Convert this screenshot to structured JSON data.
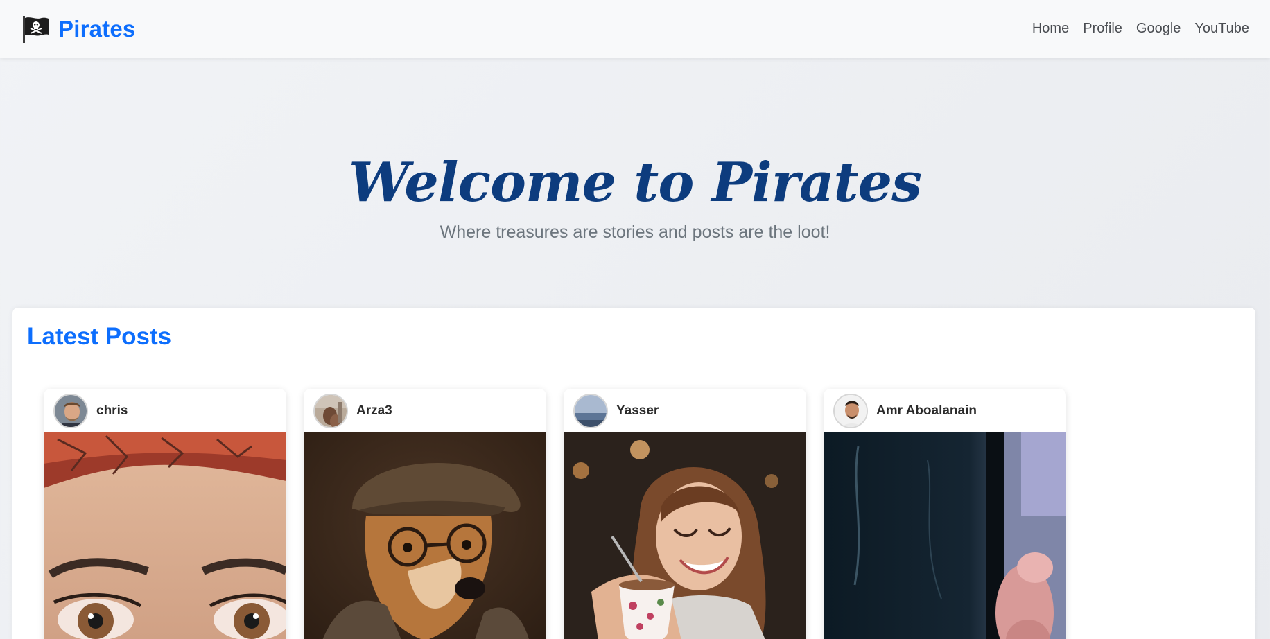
{
  "brand": {
    "name": "Pirates",
    "icon": "pirate-flag-icon"
  },
  "nav": {
    "links": [
      {
        "label": "Home"
      },
      {
        "label": "Profile"
      },
      {
        "label": "Google"
      },
      {
        "label": "YouTube"
      }
    ]
  },
  "hero": {
    "title": "Welcome to Pirates",
    "subtitle": "Where treasures are stories and posts are the loot!"
  },
  "posts_section": {
    "title": "Latest Posts",
    "posts": [
      {
        "username": "chris",
        "image": "woman-eyes-headscarf-photo"
      },
      {
        "username": "Arza3",
        "image": "dog-with-glasses-and-cap-photo"
      },
      {
        "username": "Yasser",
        "image": "woman-with-teacup-photo"
      },
      {
        "username": "Amr Aboalanain",
        "image": "blurred-hand-phone-photo"
      }
    ]
  },
  "colors": {
    "brand_blue": "#0d6efd",
    "hero_title": "#0d3c7e",
    "subtitle_gray": "#6c757d",
    "navbar_bg": "#f8f9fa"
  }
}
